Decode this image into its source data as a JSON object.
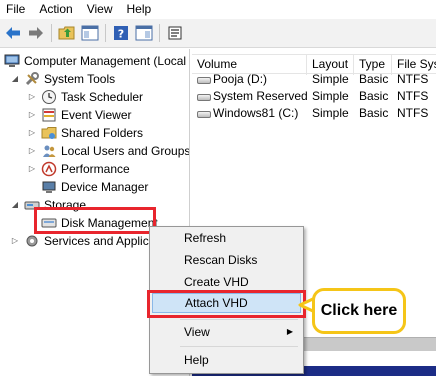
{
  "menu": {
    "file": "File",
    "action": "Action",
    "view": "View",
    "help": "Help"
  },
  "toolbar": {
    "icons": [
      "back-arrow-icon",
      "forward-arrow-icon",
      "up-folder-icon",
      "show-hide-tree-icon",
      "help-icon",
      "show-pane-icon",
      "properties-icon"
    ]
  },
  "tree": {
    "root": "Computer Management (Local",
    "system_tools": "System Tools",
    "task_scheduler": "Task Scheduler",
    "event_viewer": "Event Viewer",
    "shared_folders": "Shared Folders",
    "local_users": "Local Users and Groups",
    "performance": "Performance",
    "device_manager": "Device Manager",
    "storage": "Storage",
    "disk_management": "Disk Management",
    "services": "Services and Applica"
  },
  "volumes": {
    "columns": [
      "Volume",
      "Layout",
      "Type",
      "File Sys"
    ],
    "rows": [
      {
        "volume": "Pooja (D:)",
        "layout": "Simple",
        "type": "Basic",
        "fs": "NTFS"
      },
      {
        "volume": "System Reserved",
        "layout": "Simple",
        "type": "Basic",
        "fs": "NTFS"
      },
      {
        "volume": "Windows81 (C:)",
        "layout": "Simple",
        "type": "Basic",
        "fs": "NTFS"
      }
    ]
  },
  "context_menu": {
    "refresh": "Refresh",
    "rescan": "Rescan Disks",
    "create_vhd": "Create VHD",
    "attach_vhd": "Attach VHD",
    "view": "View",
    "help": "Help"
  },
  "callout": {
    "text": "Click here"
  },
  "colors": {
    "highlight": "#e8252d",
    "callout_border": "#f5c518",
    "selection": "#cfe4f7"
  }
}
